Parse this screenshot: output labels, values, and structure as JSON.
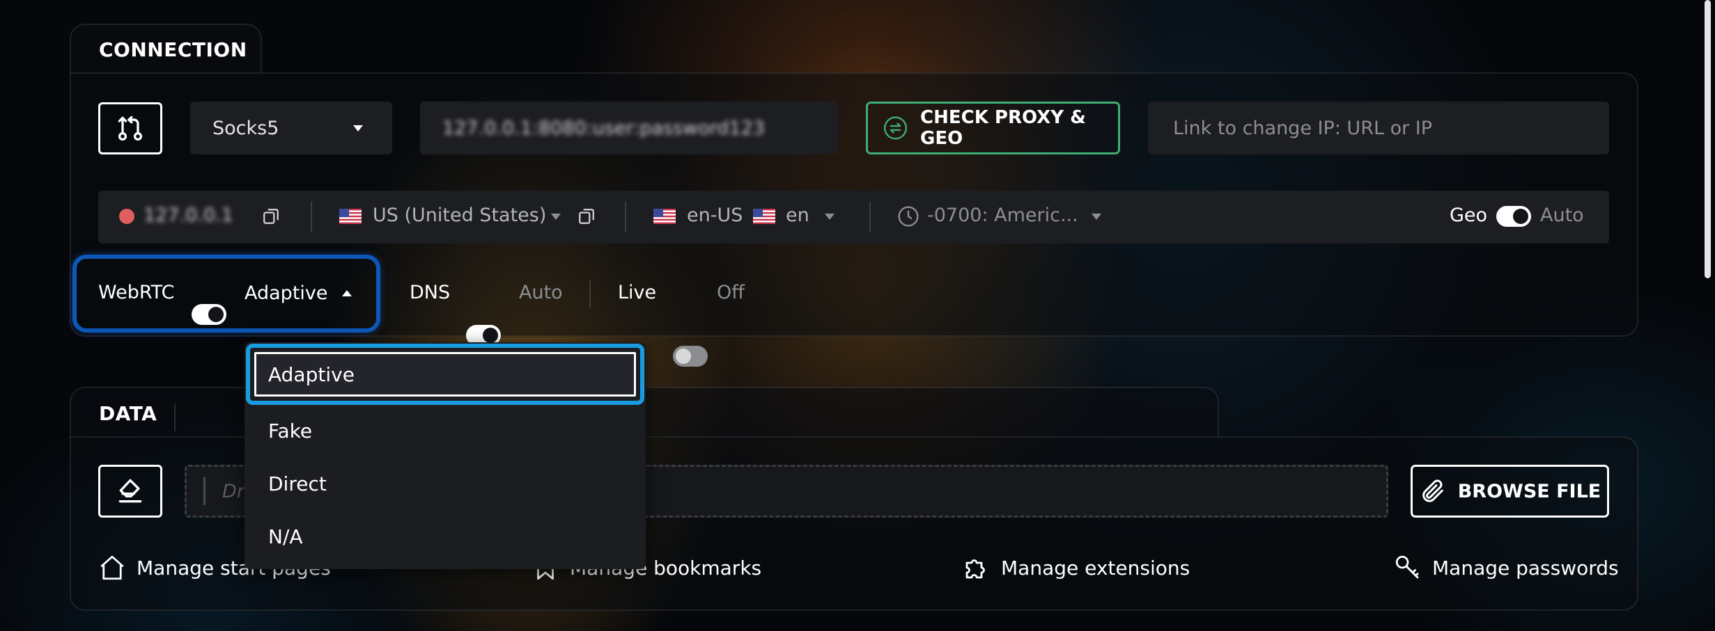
{
  "connection": {
    "tab_label": "CONNECTION",
    "proxy_type": "Socks5",
    "proxy_address": "127.0.0.1:8080:user:password123",
    "check_button": "CHECK PROXY & GEO",
    "change_ip_placeholder": "Link to change IP: URL or IP",
    "ip_value": "127.0.0.1",
    "country": "US (United States)",
    "language_primary": "en-US",
    "language_secondary": "en",
    "timezone": "-0700: Americ...",
    "geo_label": "Geo",
    "geo_mode": "Auto",
    "webrtc_label": "WebRTC",
    "webrtc_mode": "Adaptive",
    "dns_label": "DNS",
    "dns_mode": "Auto",
    "live_label": "Live",
    "live_mode": "Off"
  },
  "webrtc_menu": {
    "options": [
      "Adaptive",
      "Fake",
      "Direct",
      "N/A"
    ],
    "selected": "Adaptive"
  },
  "data": {
    "tab_label": "DATA",
    "drop_placeholder": "Dr",
    "browse_button": "BROWSE FILE",
    "links": {
      "start_pages": "Manage start pages",
      "bookmarks": "Manage bookmarks",
      "extensions": "Manage extensions",
      "passwords": "Manage passwords"
    }
  },
  "colors": {
    "check_button_border": "#3fae76",
    "webrtc_highlight": "#0d57b8",
    "menu_highlight": "#1a9be0",
    "status_dot": "#e05e5e"
  }
}
